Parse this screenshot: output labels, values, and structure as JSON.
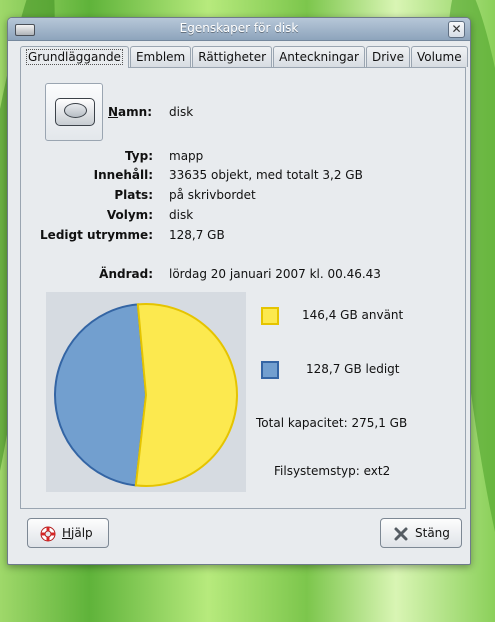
{
  "window": {
    "title": "Egenskaper för disk",
    "tabs": [
      "Grundläggande",
      "Emblem",
      "Rättigheter",
      "Anteckningar",
      "Drive",
      "Volume"
    ],
    "active_tab": "Grundläggande"
  },
  "basic": {
    "name_label": "Namn:",
    "name_value": "disk",
    "type_label": "Typ:",
    "type_value": "mapp",
    "contents_label": "Innehåll:",
    "contents_value": "33635 objekt, med totalt 3,2 GB",
    "location_label": "Plats:",
    "location_value": "på skrivbordet",
    "volume_label": "Volym:",
    "volume_value": "disk",
    "free_label": "Ledigt utrymme:",
    "free_value": "128,7 GB",
    "modified_label": "Ändrad:",
    "modified_value": "lördag 20 januari 2007 kl. 00.46.43"
  },
  "usage": {
    "used_text": "146,4 GB använt",
    "free_text": "128,7 GB ledigt",
    "capacity_text": "Total kapacitet: 275,1 GB",
    "fs_text": "Filsystemstyp: ext2",
    "used_gb": 146.4,
    "free_gb": 128.7,
    "used_color": "#fce94f",
    "used_border": "#e5c400",
    "free_color": "#729fcf",
    "free_border": "#3465a4"
  },
  "buttons": {
    "help": "Hjälp",
    "close": "Stäng"
  }
}
